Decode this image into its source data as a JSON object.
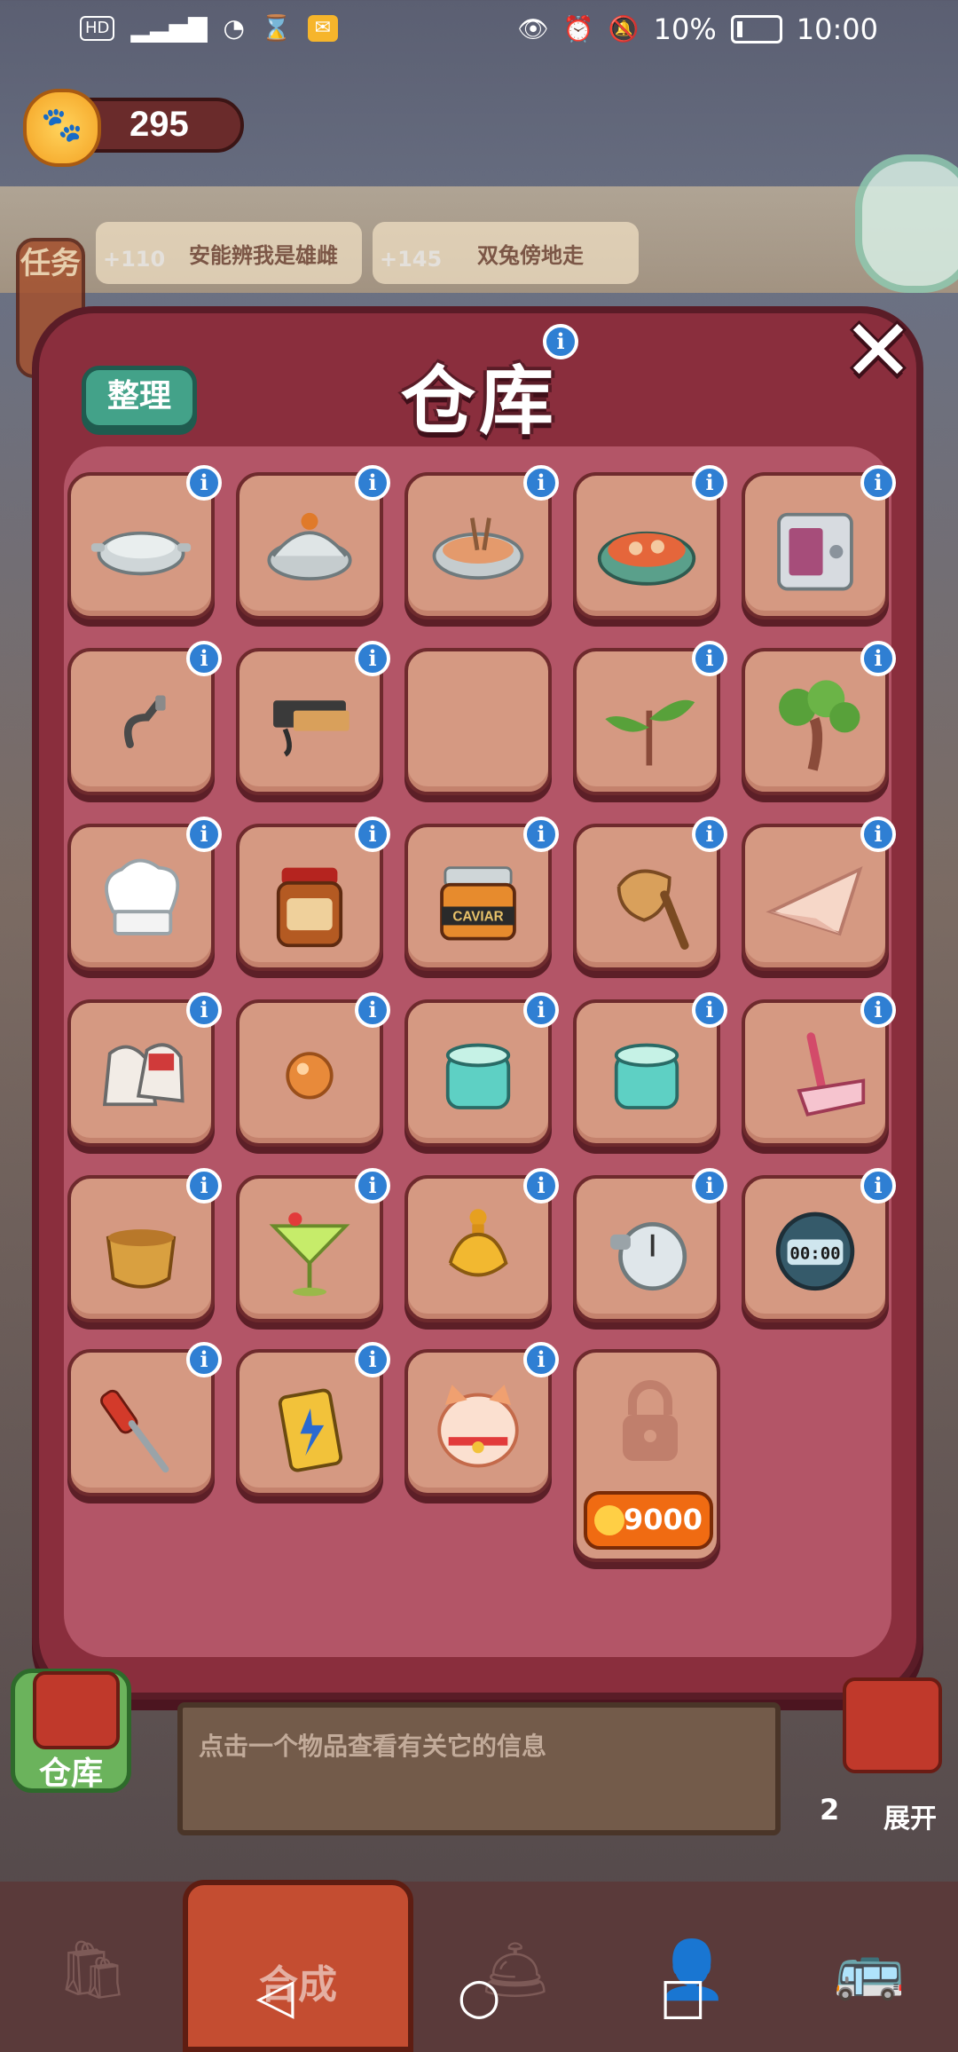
{
  "status_bar": {
    "network": "HD 4G",
    "battery": "10%",
    "time": "10:00"
  },
  "currency": {
    "amount": "295",
    "icon": "paw-coin-icon"
  },
  "background_tasks": [
    {
      "bonus": "+110",
      "name": "安能辨我是雄雌"
    },
    {
      "bonus": "+145",
      "name": "双兔傍地走"
    }
  ],
  "task_side_label": "任务",
  "panel": {
    "title": "仓库",
    "sort_button": "整理",
    "close_icon": "close-x-icon",
    "info_glyph": "i"
  },
  "items": [
    {
      "name": "empty-pot-icon"
    },
    {
      "name": "lidded-pot-icon"
    },
    {
      "name": "stew-pot-icon"
    },
    {
      "name": "hotpot-icon"
    },
    {
      "name": "safe-icon"
    },
    {
      "name": "wall-hook-icon"
    },
    {
      "name": "wall-shelf-icon"
    },
    {
      "name": "empty-slot"
    },
    {
      "name": "sprout-icon"
    },
    {
      "name": "small-tree-icon"
    },
    {
      "name": "chef-hat-icon"
    },
    {
      "name": "sauce-jar-icon"
    },
    {
      "name": "caviar-jar-icon"
    },
    {
      "name": "wooden-mallet-icon"
    },
    {
      "name": "paper-plane-icon"
    },
    {
      "name": "gloves-icon"
    },
    {
      "name": "orange-ball-icon"
    },
    {
      "name": "mint-jar-icon"
    },
    {
      "name": "mint-jar-2-icon"
    },
    {
      "name": "razor-icon"
    },
    {
      "name": "wooden-bowl-icon"
    },
    {
      "name": "cocktail-icon"
    },
    {
      "name": "golden-bottle-icon"
    },
    {
      "name": "stopwatch-icon"
    },
    {
      "name": "digital-timer-icon"
    },
    {
      "name": "screwdriver-icon"
    },
    {
      "name": "energy-drink-icon"
    },
    {
      "name": "lucky-cat-icon"
    }
  ],
  "caviar_label": "CAVIAR",
  "timer_label": "00:00",
  "locked_slot": {
    "price": "9000",
    "icon": "lock-icon"
  },
  "bottom": {
    "warehouse_button": "仓库",
    "hint_text": "点击一个物品查看有关它的信息",
    "expand_count": "2",
    "expand_label": "展开"
  },
  "tabs": {
    "active": "合成"
  },
  "nav": {
    "back": "◁",
    "home": "○",
    "recent": "□"
  }
}
